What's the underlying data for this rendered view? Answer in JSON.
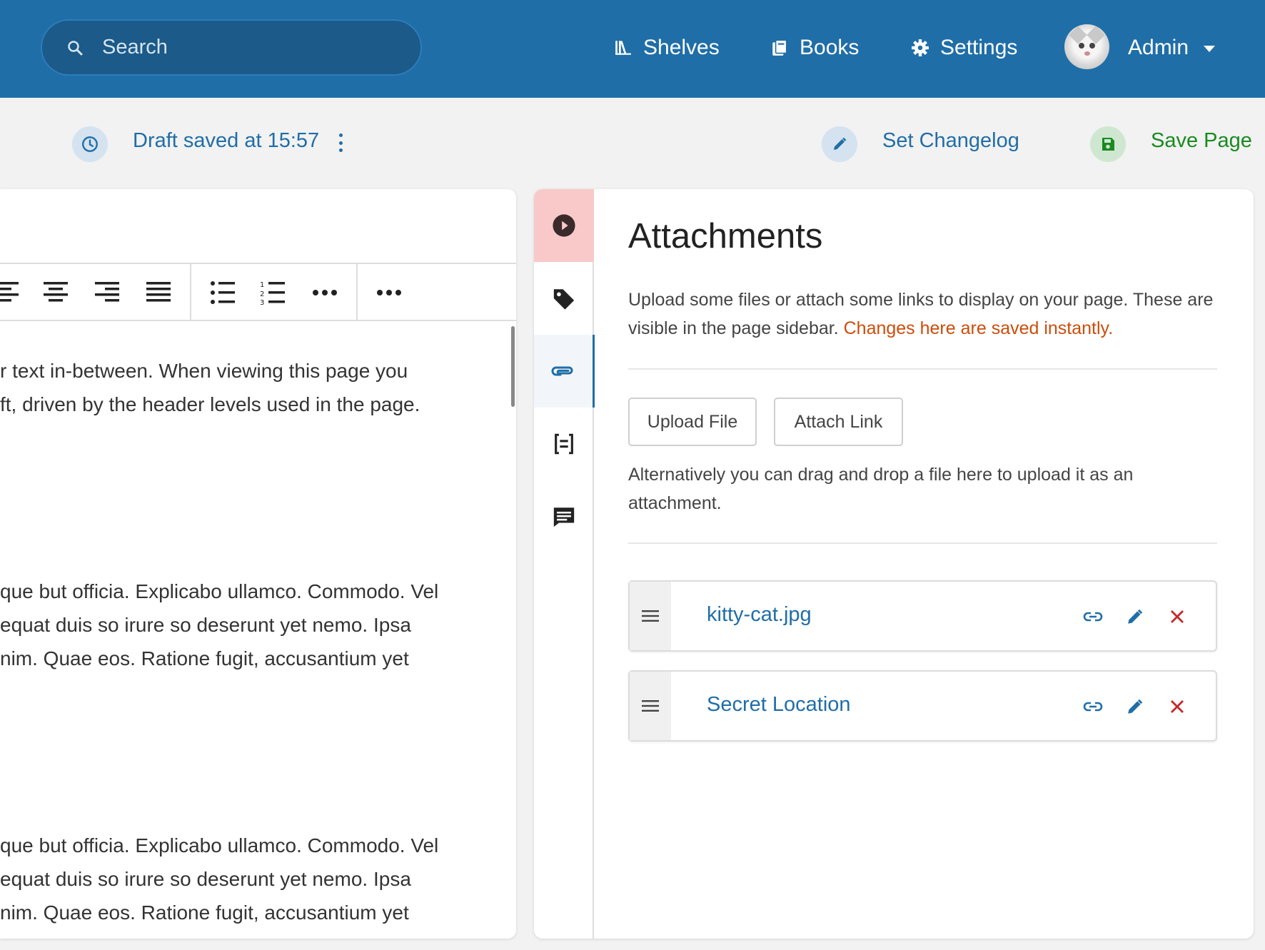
{
  "header": {
    "search_placeholder": "Search",
    "nav": [
      {
        "label": "Shelves",
        "icon": "shelves-icon"
      },
      {
        "label": "Books",
        "icon": "books-icon"
      },
      {
        "label": "Settings",
        "icon": "gear-icon"
      }
    ],
    "user": {
      "name": "Admin"
    }
  },
  "editor_bar": {
    "draft_status": "Draft saved at 15:57",
    "changelog_label": "Set Changelog",
    "save_label": "Save Page"
  },
  "editor": {
    "paragraphs": [
      [
        "r text in-between. When viewing this page you",
        "ft, driven by the header levels used in the page."
      ],
      [
        "que but officia. Explicabo ullamco. Commodo. Vel",
        "equat duis so irure so deserunt yet nemo. Ipsa",
        "nim. Quae eos. Ratione fugit, accusantium yet"
      ],
      [
        "que but officia. Explicabo ullamco. Commodo. Vel",
        "equat duis so irure so deserunt yet nemo. Ipsa",
        "nim. Quae eos. Ratione fugit, accusantium yet"
      ]
    ]
  },
  "attachments": {
    "title": "Attachments",
    "description": "Upload some files or attach some links to display on your page. These are visible in the page sidebar.",
    "description_warning": "Changes here are saved instantly.",
    "upload_label": "Upload File",
    "attach_link_label": "Attach Link",
    "drop_hint": "Alternatively you can drag and drop a file here to upload it as an attachment.",
    "items": [
      {
        "name": "kitty-cat.jpg"
      },
      {
        "name": "Secret Location"
      }
    ]
  },
  "colors": {
    "header": "#206ea7",
    "link": "#206ea7",
    "save": "#1a8a21",
    "warning": "#cc4d0b",
    "delete": "#c62828"
  }
}
